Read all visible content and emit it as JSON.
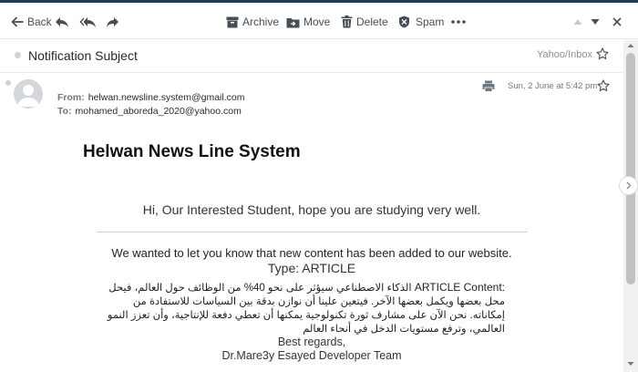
{
  "toolbar": {
    "back_label": "Back",
    "archive_label": "Archive",
    "move_label": "Move",
    "delete_label": "Delete",
    "spam_label": "Spam",
    "icons": [
      "reply-icon",
      "reply-all-icon",
      "forward-icon",
      "more-icon",
      "previous-icon",
      "next-icon"
    ]
  },
  "subject": "Notification Subject",
  "folder": "Yahoo/Inbox",
  "message": {
    "from_label": "From:",
    "from": "helwan.newsline.system@gmail.com",
    "to_label": "To:",
    "to": "mohamed_aboreda_2020@yahoo.com",
    "date": "Sun, 2 June at 5:42 pm"
  },
  "body": {
    "title": "Helwan News Line System",
    "greeting": "Hi, Our Interested Student, hope you are studying very well.",
    "notice": "We wanted to let you know that new content has been added to our website.",
    "type_line": "Type: ARTICLE",
    "article_label": "ARTICLE Content:",
    "article_text": "الذكاء الاصطناعي سيؤثر على نحو 40% من الوظائف حول العالم، فيحل محل بعضها ويكمل بعضها الآخر. فيتعين علينا أن نوازن بدقة بين السياسات للاستفادة من إمكاناته. نحن الآن على مشارف ثورة تكنولوجية يمكنها أن تعطي دفعة للإنتاجية، وأن تعزز النمو العالمي، وترفع مستويات الدخل في أنحاء العالم",
    "regards": "Best regards,",
    "team": "Dr.Mare3y Esayed Developer Team"
  },
  "colors": {
    "accent_line": "#1d3b5a",
    "toolbar_text": "#464e56",
    "scroll_thumb": "#c1c1c1"
  }
}
